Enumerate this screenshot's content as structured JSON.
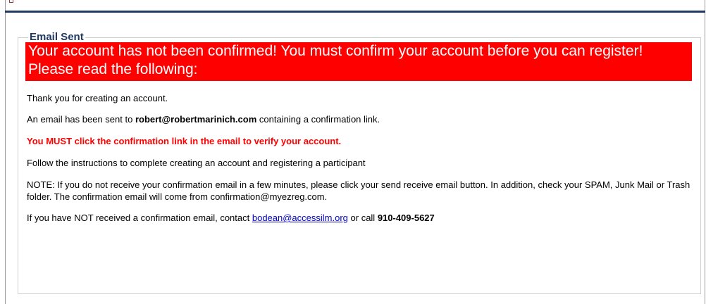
{
  "panel": {
    "title": "Email Sent",
    "alert": "Your account has not been confirmed! You must confirm your account before you can register! Please read the following:"
  },
  "messages": {
    "thanks": "Thank you for creating an account.",
    "sent_prefix": "An email has been sent to ",
    "sent_email": "robert@robertmarinich.com",
    "sent_suffix": " containing a confirmation link.",
    "must_click": "You MUST click the confirmation link in the email to verify your account.",
    "instructions": "Follow the instructions to complete creating an account and registering a participant",
    "note": "NOTE: If you do not receive your confirmation email in a few minutes, please click your send receive email button. In addition, check your SPAM, Junk Mail or Trash folder. The confirmation email will come from confirmation@myezreg.com.",
    "contact_prefix": "If you have NOT received a confirmation email, contact ",
    "contact_email": "bodean@accessilm.org",
    "contact_middle": " or call ",
    "contact_phone": "910-409-5627"
  },
  "colors": {
    "alert_background": "#ff0000",
    "title_color": "#1f3864",
    "warning_text": "#ff0000",
    "link": "#0000cc"
  }
}
